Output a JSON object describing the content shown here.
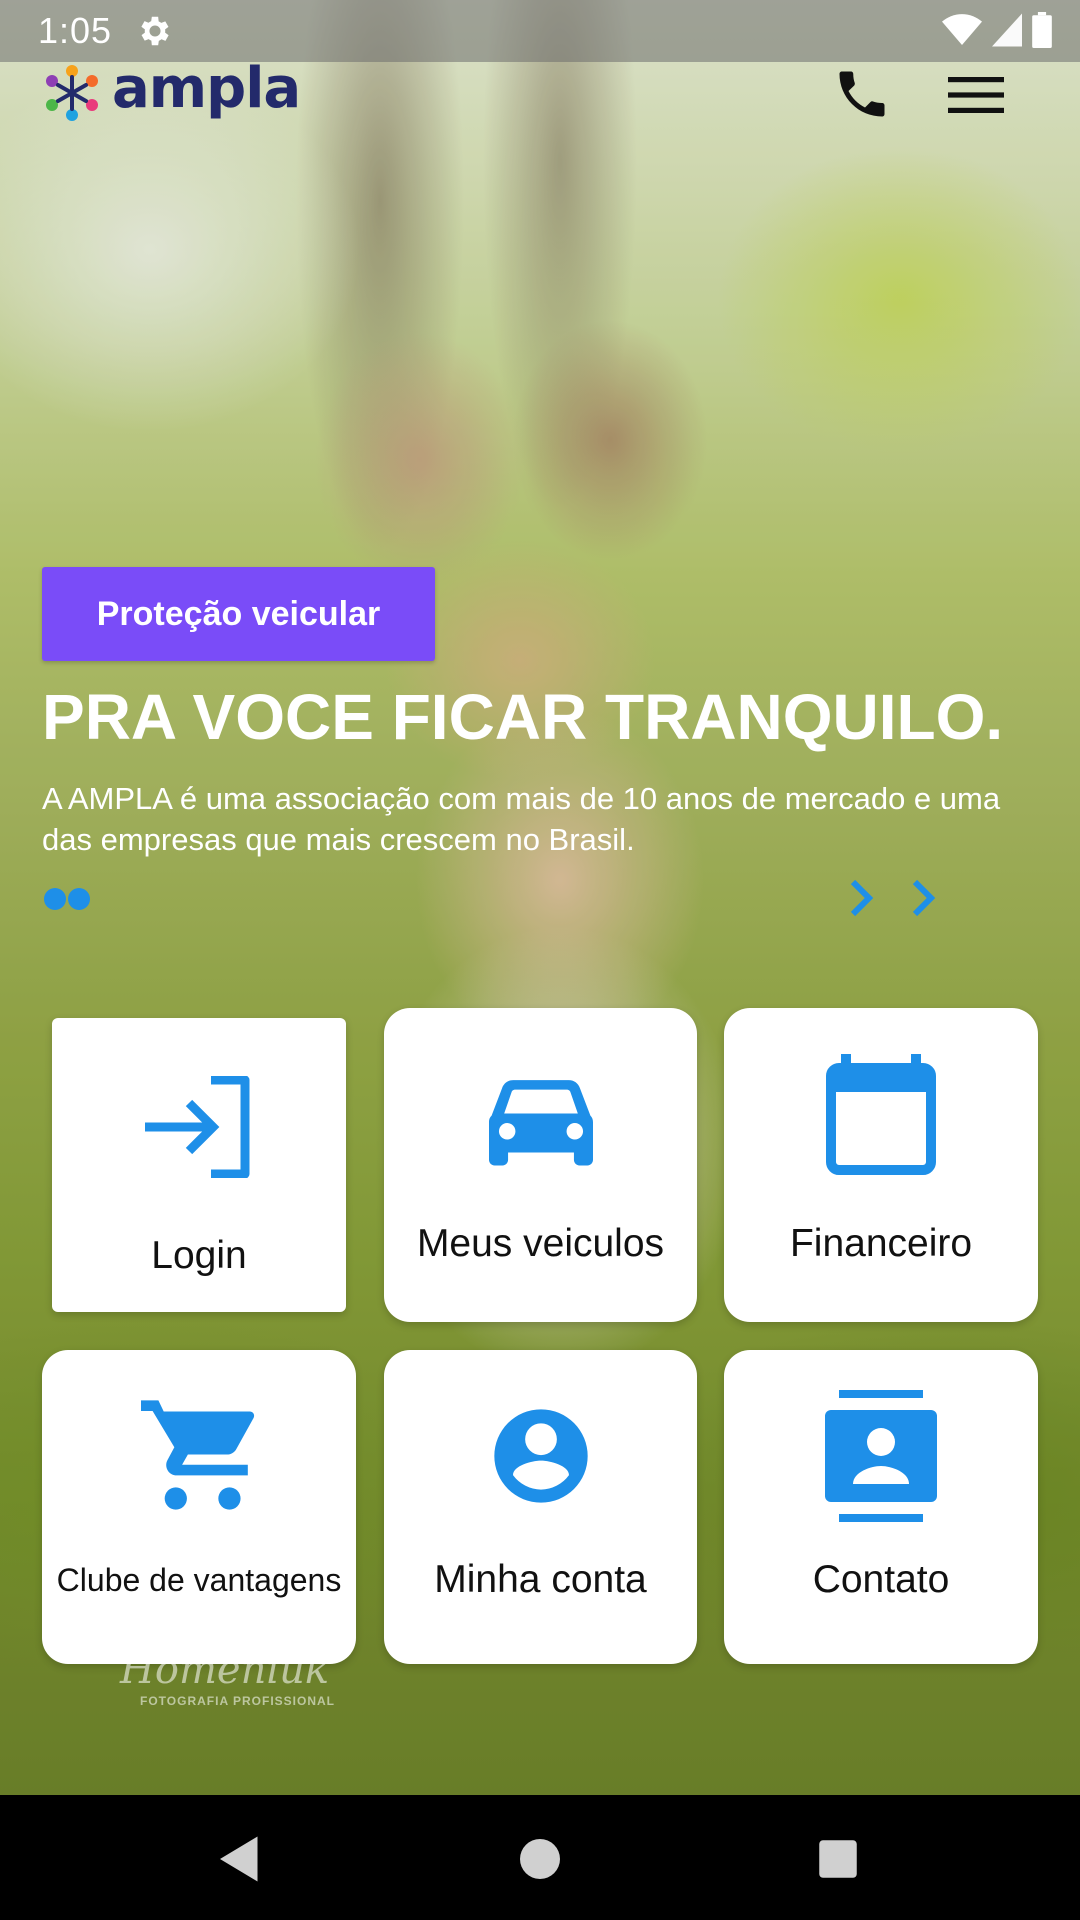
{
  "status_bar": {
    "time": "1:05",
    "icons": [
      "gear-icon",
      "wifi-icon",
      "cell-signal-icon",
      "battery-icon"
    ]
  },
  "header": {
    "logo_text": "ampla",
    "phone_icon": "phone-icon",
    "menu_icon": "hamburger-menu-icon"
  },
  "hero": {
    "badge": "Proteção veicular",
    "title": "PRA VOCE FICAR TRANQUILO.",
    "text": "A AMPLA é uma associação com mais de 10 anos de mercado e uma das empresas que mais crescem no Brasil.",
    "slide_count": 2
  },
  "tiles": [
    {
      "label": "Login",
      "icon": "login-icon"
    },
    {
      "label": "Meus veiculos",
      "icon": "car-icon"
    },
    {
      "label": "Financeiro",
      "icon": "calendar-icon"
    },
    {
      "label": "Clube de vantagens",
      "icon": "shopping-cart-icon"
    },
    {
      "label": "Minha conta",
      "icon": "account-circle-icon"
    },
    {
      "label": "Contato",
      "icon": "contact-card-icon"
    }
  ],
  "watermark": {
    "name": "Homeniuk",
    "sub": "FOTOGRAFIA PROFISSIONAL"
  },
  "nav_bar": {
    "buttons": [
      "back-icon",
      "home-icon",
      "recents-icon"
    ]
  },
  "colors": {
    "accent_blue": "#1e8fe8",
    "badge_purple": "#7a4cf8",
    "logo_navy": "#232a6b"
  }
}
